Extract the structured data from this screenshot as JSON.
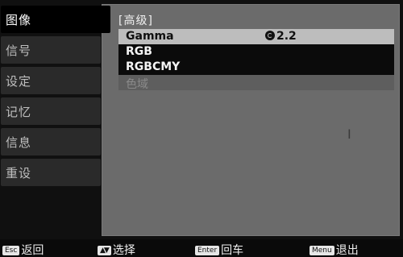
{
  "sidebar": {
    "items": [
      {
        "label": "图像"
      },
      {
        "label": "信号"
      },
      {
        "label": "设定"
      },
      {
        "label": "记忆"
      },
      {
        "label": "信息"
      },
      {
        "label": "重设"
      }
    ]
  },
  "panel": {
    "title": "[高级]",
    "rows": [
      {
        "label": "Gamma",
        "value": "2.2",
        "state": "selected"
      },
      {
        "label": "RGB",
        "state": "normal"
      },
      {
        "label": "RGBCMY",
        "state": "normal"
      },
      {
        "label": "色域",
        "state": "disabled"
      }
    ],
    "cursor_glyph": "I"
  },
  "footer": {
    "esc": {
      "key": "Esc",
      "label": "返回"
    },
    "arrows": {
      "key": "▲▼",
      "label": "选择"
    },
    "enter": {
      "key": "Enter",
      "label": "回车"
    },
    "menu": {
      "key": "Menu",
      "label": "退出"
    }
  },
  "colors": {
    "panel_bg": "#6b6b6b",
    "selected_row": "#bdbdbd",
    "normal_row": "#0b0b0b",
    "active_tab": "#000000",
    "inactive_tab": "#2a2a2a"
  },
  "icons": {
    "gamma_value": "adjust-dial-icon"
  }
}
